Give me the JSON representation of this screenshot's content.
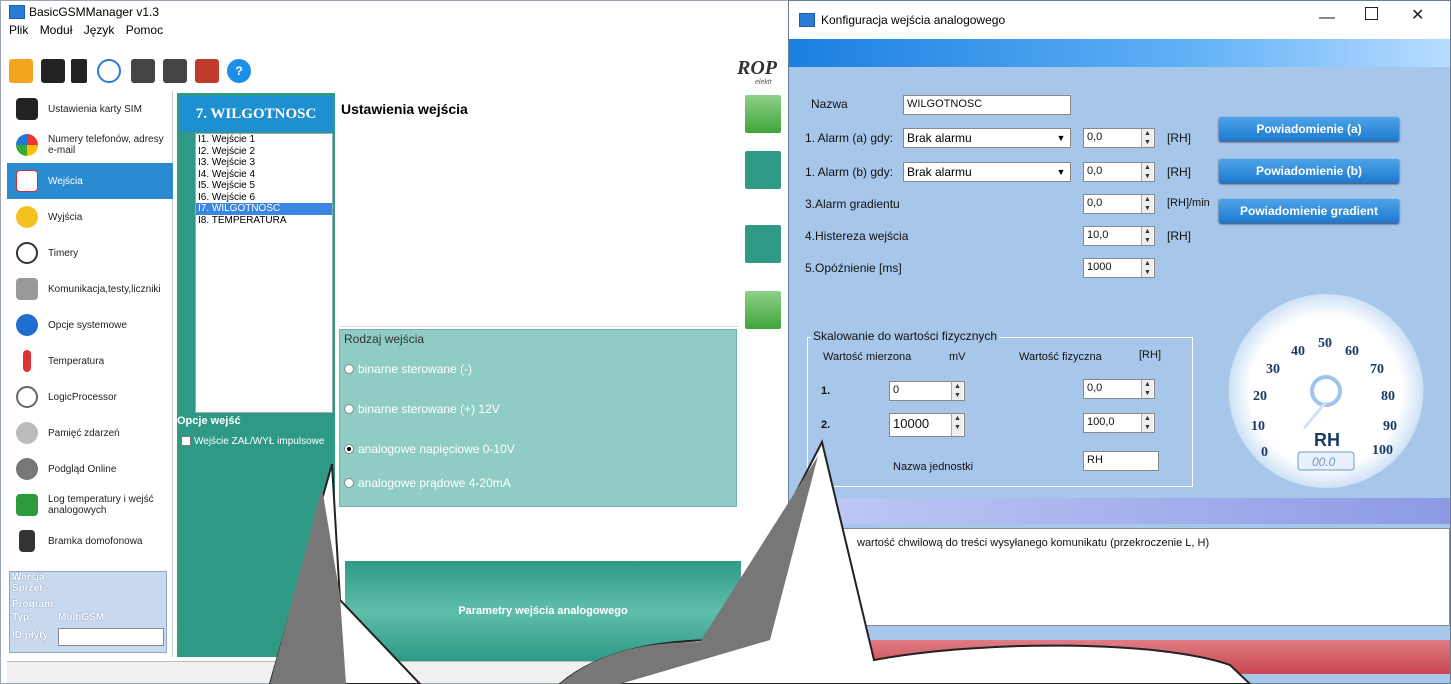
{
  "main": {
    "title": "BasicGSMManager v1.3",
    "menu": [
      "Plik",
      "Moduł",
      "Język",
      "Pomoc"
    ],
    "logo_text": "ROP",
    "logo_sub": "elektr",
    "sidebar": [
      {
        "label": "Ustawienia karty SIM",
        "icon": "sim-card-icon"
      },
      {
        "label": "Numery telefonów, adresy e-mail",
        "icon": "contacts-icon"
      },
      {
        "label": "Wejścia",
        "icon": "inputs-icon",
        "selected": true
      },
      {
        "label": "Wyjścia",
        "icon": "outputs-bulb-icon"
      },
      {
        "label": "Timery",
        "icon": "clock-icon"
      },
      {
        "label": "Komunikacja,testy,liczniki",
        "icon": "tools-icon"
      },
      {
        "label": "Opcje systemowe",
        "icon": "gear-icon"
      },
      {
        "label": "Temperatura",
        "icon": "thermometer-icon"
      },
      {
        "label": "LogicProcessor",
        "icon": "logic-icon"
      },
      {
        "label": "Pamięć zdarzeń",
        "icon": "events-icon"
      },
      {
        "label": "Podgląd Online",
        "icon": "online-preview-icon"
      },
      {
        "label": "Log temperatury i wejść analogowych",
        "icon": "log-icon"
      },
      {
        "label": "Bramka domofonowa",
        "icon": "intercom-icon"
      }
    ],
    "version": {
      "title": "Wersja",
      "sprzet": "Sprzęt :",
      "program": "Program:",
      "typ_label": "Typ:",
      "typ_value": "MultiGSM",
      "id_label": "ID płyty"
    },
    "panel_title": "7. WILGOTNOSC",
    "inputs": [
      "I1. Wejście 1",
      "I2. Wejście 2",
      "I3. Wejście 3",
      "I4. Wejście 4",
      "I5. Wejście 5",
      "I6. Wejście 6",
      "I7. WILGOTNOSC",
      "I8. TEMPERATURA"
    ],
    "selected_input_index": 6,
    "opcje_title": "Opcje wejść",
    "opcje_checkbox": "Wejście ZAŁ/WYŁ impulsowe",
    "ustawienia_title": "Ustawienia wejścia",
    "rodzaj_title": "Rodzaj wejścia",
    "rodzaj_options": [
      "binarne sterowane (-)",
      "binarne sterowane (+) 12V",
      "analogowe napięciowe 0-10V",
      "analogowe prądowe 4-20mA"
    ],
    "rodzaj_selected_index": 2,
    "params_button": "Parametry wejścia analogowego"
  },
  "dialog": {
    "title": "Konfiguracja wejścia analogowego",
    "nazwa_label": "Nazwa",
    "nazwa_value": "WILGOTNOSC",
    "alarm_a_label": "1. Alarm (a) gdy:",
    "alarm_a_select": "Brak alarmu",
    "alarm_a_value": "0,0",
    "alarm_b_label": "1. Alarm (b) gdy:",
    "alarm_b_select": "Brak alarmu",
    "alarm_b_value": "0,0",
    "gradient_label": "3.Alarm gradientu",
    "gradient_value": "0,0",
    "histereza_label": "4.Histereza wejścia",
    "histereza_value": "10,0",
    "opoznienie_label": "5.Opóźnienie [ms]",
    "opoznienie_value": "1000",
    "unit_rh": "[RH]",
    "unit_rh_min": "[RH]/min",
    "btn_a": "Powiadomienie (a)",
    "btn_b": "Powiadomienie (b)",
    "btn_grad": "Powiadomienie gradient",
    "skal_title": "Skalowanie do wartości fizycznych",
    "col_measured": "Wartość mierzona",
    "col_mv": "mV",
    "col_physical": "Wartość fizyczna",
    "col_rh": "[RH]",
    "row1_label": "1.",
    "row1_mv": "0",
    "row1_phys": "0,0",
    "row2_label": "2.",
    "row2_mv": "10000",
    "row2_phys": "100,0",
    "unit_name_label": "Nazwa jednostki",
    "unit_name_value": "RH",
    "gauge_unit": "RH",
    "gauge_ticks": [
      "0",
      "10",
      "20",
      "30",
      "40",
      "50",
      "60",
      "70",
      "80",
      "90",
      "100"
    ],
    "gauge_display": "00.0",
    "message_text": "wartość chwilową do treści wysyłanego komunikatu (przekroczenie L, H)"
  },
  "colors": {
    "accent_blue": "#1e8fd0",
    "panel_green": "#2e9a86",
    "dialog_bg": "#a7c7ea"
  }
}
